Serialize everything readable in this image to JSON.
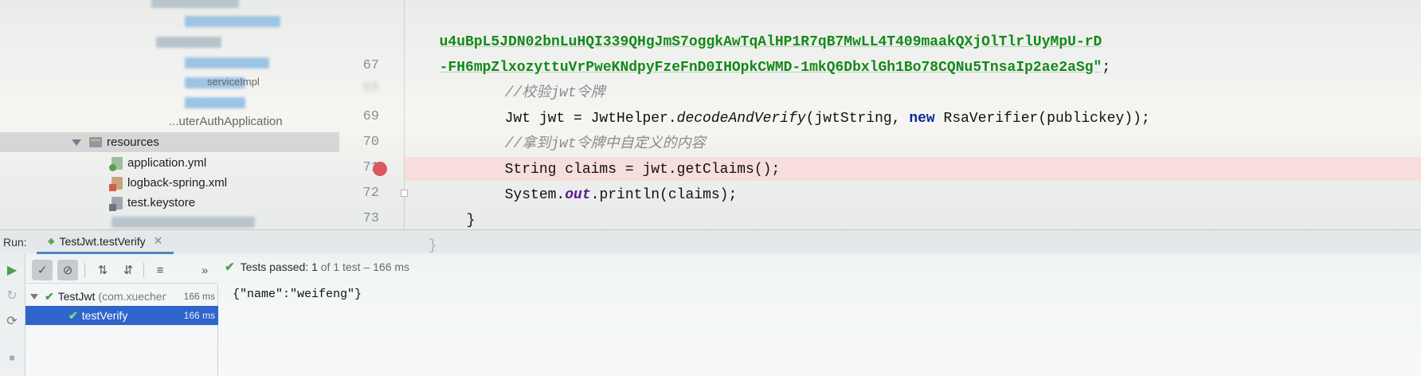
{
  "project_tree": {
    "resources_label": "resources",
    "files": [
      {
        "name": "application.yml",
        "icon": "yml-file-icon"
      },
      {
        "name": "logback-spring.xml",
        "icon": "xml-file-icon"
      },
      {
        "name": "test.keystore",
        "icon": "keystore-file-icon"
      }
    ],
    "partial_items": [
      "serviceImpl",
      "...uterAuthApplication"
    ]
  },
  "editor": {
    "lines": [
      {
        "num": "",
        "code_string": "u4uBpL5JDN02bnLuHQI339QHgJmS7oggkAwTqAlHP1R7qB7MwLL4T409maakQXjOlTlrlUyMpU-rD"
      },
      {
        "num": "",
        "code_string": "-FH6mpZlxozyttuVrPweKNdpyFzeFnD0IHOpkCWMD-1mkQ6DbxlGh1Bo78CQNu5TnsaIp2ae2aSg\"",
        "code_tail": ";"
      },
      {
        "num": "67",
        "comment": "//校验jwt令牌"
      },
      {
        "num": "",
        "code_a": "Jwt jwt = JwtHelper.",
        "method": "decodeAndVerify",
        "code_b": "(jwtString, ",
        "keyword": "new",
        "code_c": " RsaVerifier(publickey));"
      },
      {
        "num": "69",
        "comment": "//拿到jwt令牌中自定义的内容"
      },
      {
        "num": "70",
        "code": "String claims = jwt.getClaims();"
      },
      {
        "num": "71",
        "code_a": "System.",
        "static_field": "out",
        "code_b": ".println(claims);",
        "breakpoint": true
      },
      {
        "num": "72",
        "code": "}"
      },
      {
        "num": "73",
        "code": "}"
      }
    ]
  },
  "run_panel": {
    "label": "Run:",
    "tab_label": "TestJwt.testVerify",
    "status": {
      "passed_label": "Tests passed:",
      "count": "1",
      "of_text": "of 1 test – 166 ms"
    },
    "tests": [
      {
        "name": "TestJwt",
        "package": "(com.xuecheng",
        "time": "166 ms"
      },
      {
        "name": "testVerify",
        "time": "166 ms",
        "selected": true
      }
    ],
    "console_output": "{\"name\":\"weifeng\"}"
  },
  "colors": {
    "selection": "#2f65ca",
    "pass_green": "#4d9e4f",
    "breakpoint_red": "#db5860",
    "string_green": "#14891a",
    "keyword_blue": "#0a2b95"
  }
}
